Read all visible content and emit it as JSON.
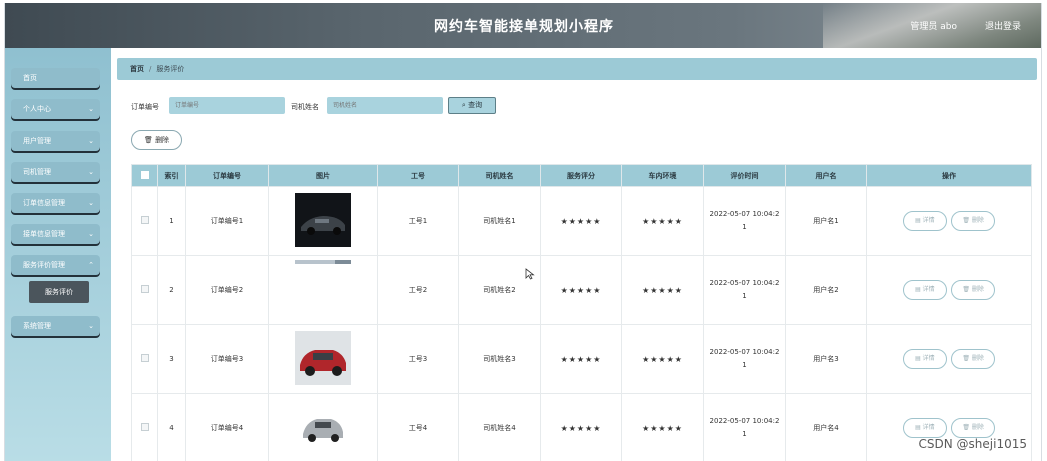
{
  "header": {
    "title": "网约车智能接单规划小程序",
    "admin": "管理员 abo",
    "logout": "退出登录"
  },
  "sidebar": {
    "items": [
      {
        "label": "首页",
        "chevron": false
      },
      {
        "label": "个人中心",
        "chevron": true
      },
      {
        "label": "用户管理",
        "chevron": true
      },
      {
        "label": "司机管理",
        "chevron": true
      },
      {
        "label": "订单信息管理",
        "chevron": true
      },
      {
        "label": "接单信息管理",
        "chevron": true
      },
      {
        "label": "服务评价管理",
        "chevron": true
      },
      {
        "label": "系统管理",
        "chevron": true
      }
    ],
    "active_sub": "服务评价"
  },
  "breadcrumb": {
    "home": "首页",
    "sep": "/",
    "current": "服务评价"
  },
  "search": {
    "order_label": "订单编号",
    "order_placeholder": "订单编号",
    "driver_label": "司机姓名",
    "driver_placeholder": "司机姓名",
    "query_label": "查询"
  },
  "toolbar": {
    "delete_label": "删除"
  },
  "table": {
    "headers": [
      "",
      "索引",
      "订单编号",
      "图片",
      "工号",
      "司机姓名",
      "服务评分",
      "车内环境",
      "评价时间",
      "用户名",
      "操作"
    ],
    "rows": [
      {
        "index": "1",
        "order": "订单编号1",
        "image": "black-sedan",
        "job": "工号1",
        "driver": "司机姓名1",
        "score": "★★★★★",
        "env": "★★★★★",
        "time_a": "2022-05-07 10:04:2",
        "time_b": "1",
        "user": "用户名1"
      },
      {
        "index": "2",
        "order": "订单编号2",
        "image": "broken-image-strip",
        "job": "工号2",
        "driver": "司机姓名2",
        "score": "★★★★★",
        "env": "★★★★★",
        "time_a": "2022-05-07 10:04:2",
        "time_b": "1",
        "user": "用户名2"
      },
      {
        "index": "3",
        "order": "订单编号3",
        "image": "red-suv",
        "job": "工号3",
        "driver": "司机姓名3",
        "score": "★★★★★",
        "env": "★★★★★",
        "time_a": "2022-05-07 10:04:2",
        "time_b": "1",
        "user": "用户名3"
      },
      {
        "index": "4",
        "order": "订单编号4",
        "image": "silver-suv",
        "job": "工号4",
        "driver": "司机姓名4",
        "score": "★★★★★",
        "env": "★★★★★",
        "time_a": "2022-05-07 10:04:2",
        "time_b": "1",
        "user": "用户名4"
      }
    ],
    "detail_label": "详情",
    "row_delete_label": "删除"
  },
  "watermark": "CSDN @sheji1015",
  "colors": {
    "header": "#4f5b63",
    "sidebar": "#8fc0d0",
    "accent": "#9ccad6"
  }
}
